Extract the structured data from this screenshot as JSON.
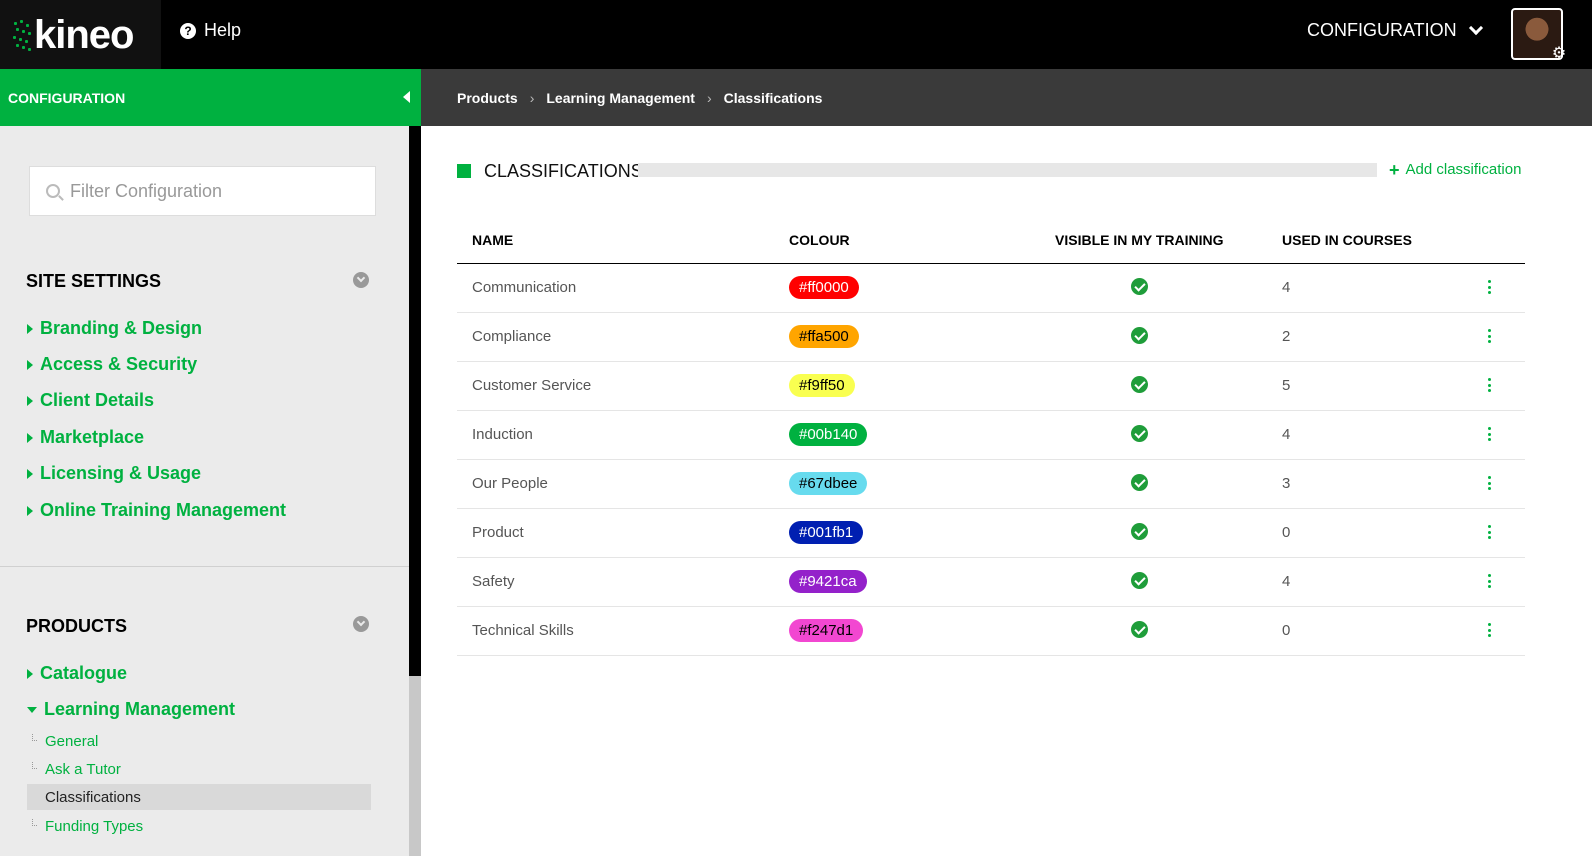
{
  "brand": {
    "logo_text": "kineo",
    "accent": "#00b140"
  },
  "topbar": {
    "help_label": "Help",
    "help_icon": "question-circle-icon",
    "config_label": "CONFIGURATION",
    "avatar_badge_icon": "gear-icon"
  },
  "sidebar": {
    "header": "CONFIGURATION",
    "filter_placeholder": "Filter Configuration",
    "sections": [
      {
        "title": "SITE SETTINGS",
        "items": [
          "Branding & Design",
          "Access & Security",
          "Client Details",
          "Marketplace",
          "Licensing & Usage",
          "Online Training Management"
        ]
      },
      {
        "title": "PRODUCTS",
        "items": [
          "Catalogue",
          "Learning Management"
        ],
        "subitems": [
          "General",
          "Ask a Tutor",
          "Classifications",
          "Funding Types"
        ],
        "active_subitem": "Classifications"
      }
    ]
  },
  "breadcrumb": [
    "Products",
    "Learning Management",
    "Classifications"
  ],
  "main": {
    "title": "CLASSIFICATIONS",
    "add_label": "Add classification",
    "columns": [
      "NAME",
      "COLOUR",
      "VISIBLE IN MY TRAINING",
      "USED IN COURSES"
    ],
    "rows": [
      {
        "name": "Communication",
        "colour": "#ff0000",
        "visible": true,
        "used": "4"
      },
      {
        "name": "Compliance",
        "colour": "#ffa500",
        "visible": true,
        "used": "2"
      },
      {
        "name": "Customer Service",
        "colour": "#f9ff50",
        "visible": true,
        "used": "5"
      },
      {
        "name": "Induction",
        "colour": "#00b140",
        "visible": true,
        "used": "4"
      },
      {
        "name": "Our People",
        "colour": "#67dbee",
        "visible": true,
        "used": "3"
      },
      {
        "name": "Product",
        "colour": "#001fb1",
        "visible": true,
        "used": "0"
      },
      {
        "name": "Safety",
        "colour": "#9421ca",
        "visible": true,
        "used": "4"
      },
      {
        "name": "Technical Skills",
        "colour": "#f247d1",
        "visible": true,
        "used": "0"
      }
    ]
  }
}
